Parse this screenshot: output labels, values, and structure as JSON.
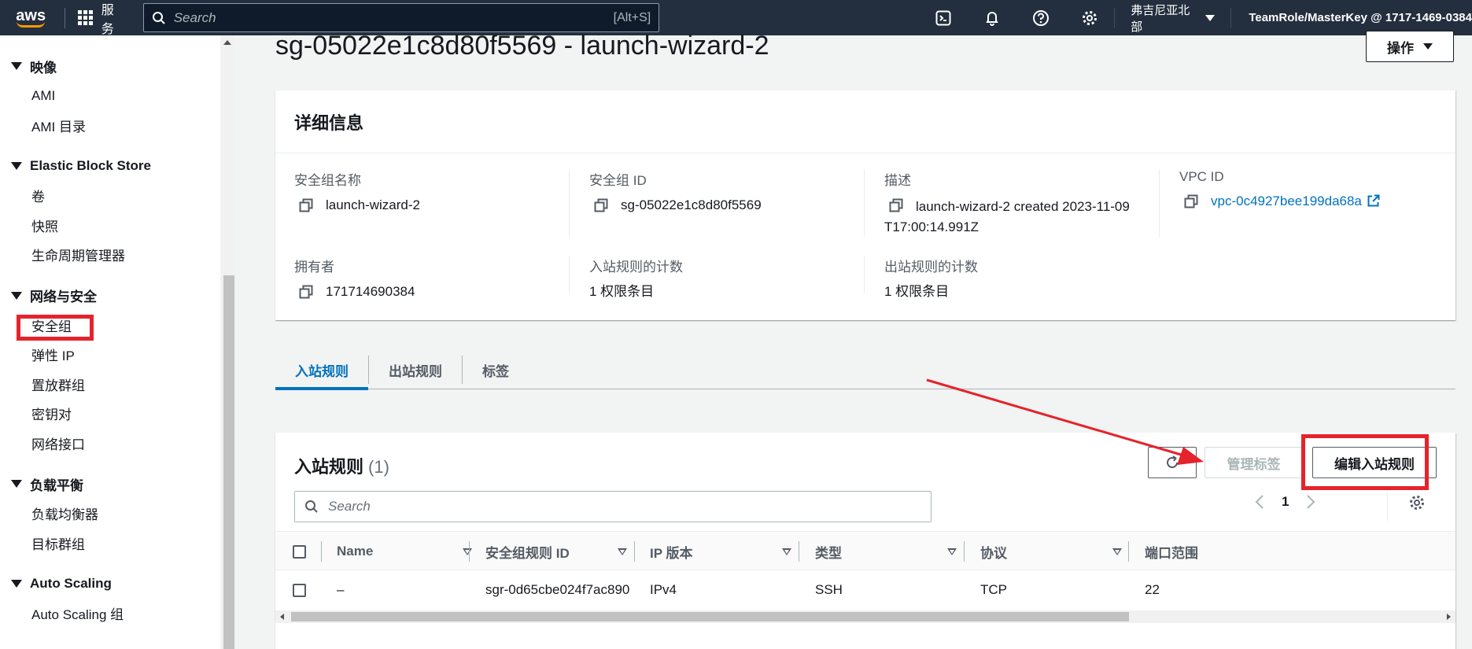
{
  "topnav": {
    "logo": "aws",
    "services_label": "服务",
    "search_placeholder": "Search",
    "search_shortcut": "[Alt+S]",
    "region": "弗吉尼亚北部",
    "account": "TeamRole/MasterKey @ 1717-1469-0384"
  },
  "sidebar": {
    "sections": [
      {
        "title": "映像",
        "items": [
          "AMI",
          "AMI 目录"
        ]
      },
      {
        "title": "Elastic Block Store",
        "items": [
          "卷",
          "快照",
          "生命周期管理器"
        ]
      },
      {
        "title": "网络与安全",
        "items": [
          "安全组",
          "弹性 IP",
          "置放群组",
          "密钥对",
          "网络接口"
        ]
      },
      {
        "title": "负载平衡",
        "items": [
          "负载均衡器",
          "目标群组"
        ]
      },
      {
        "title": "Auto Scaling",
        "items": [
          "Auto Scaling 组"
        ]
      }
    ]
  },
  "page": {
    "title": "sg-05022e1c8d80f5569 - launch-wizard-2",
    "actions_label": "操作"
  },
  "details": {
    "header": "详细信息",
    "fields": {
      "sg_name": {
        "label": "安全组名称",
        "value": "launch-wizard-2"
      },
      "sg_id": {
        "label": "安全组 ID",
        "value": "sg-05022e1c8d80f5569"
      },
      "desc": {
        "label": "描述",
        "value": "launch-wizard-2 created 2023-11-09T17:00:14.991Z"
      },
      "vpc": {
        "label": "VPC ID",
        "value": "vpc-0c4927bee199da68a"
      },
      "owner": {
        "label": "拥有者",
        "value": "171714690384"
      },
      "inbound_count": {
        "label": "入站规则的计数",
        "value": "1 权限条目"
      },
      "outbound_count": {
        "label": "出站规则的计数",
        "value": "1 权限条目"
      }
    }
  },
  "tabs": [
    "入站规则",
    "出站规则",
    "标签"
  ],
  "rules": {
    "title": "入站规则",
    "count": "(1)",
    "manage_tags": "管理标签",
    "edit_rules": "编辑入站规则",
    "search_placeholder": "Search",
    "page": "1",
    "columns": [
      "Name",
      "安全组规则 ID",
      "IP 版本",
      "类型",
      "协议",
      "端口范围"
    ],
    "rows": [
      {
        "name": "–",
        "rule_id": "sgr-0d65cbe024f7ac890",
        "ip": "IPv4",
        "type": "SSH",
        "protocol": "TCP",
        "port": "22"
      }
    ]
  },
  "colors": {
    "highlight": "#e5232b",
    "link": "#0073bb",
    "nav_bg": "#232f3e"
  }
}
